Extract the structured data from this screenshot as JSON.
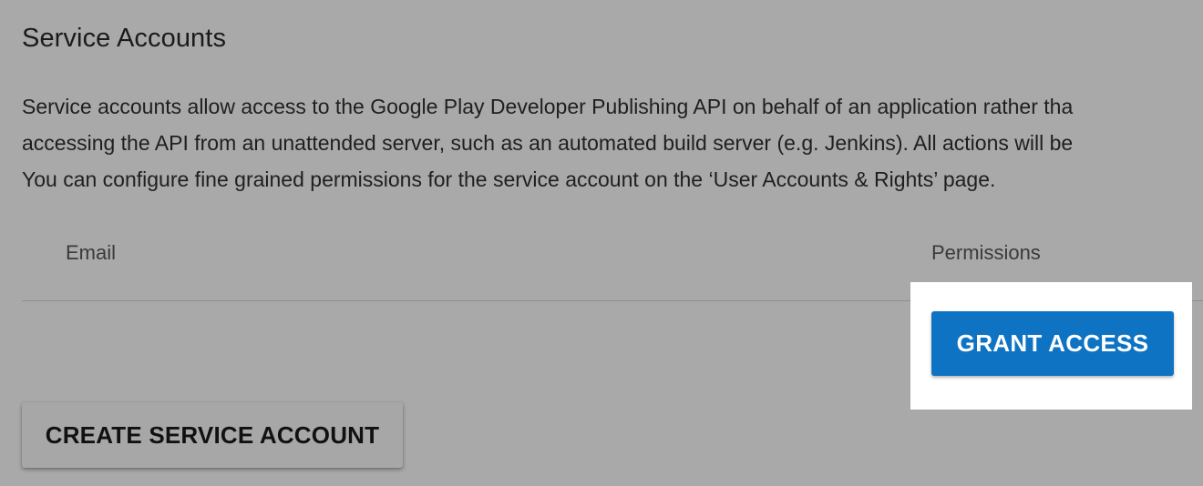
{
  "section": {
    "title": "Service Accounts",
    "description_lines": [
      "Service accounts allow access to the Google Play Developer Publishing API on behalf of an application rather tha",
      "accessing the API from an unattended server, such as an automated build server (e.g. Jenkins). All actions will be",
      "You can configure fine grained permissions for the service account on the ‘User Accounts & Rights’ page."
    ]
  },
  "table": {
    "columns": {
      "email": "Email",
      "permissions": "Permissions"
    }
  },
  "buttons": {
    "grant_access": "GRANT ACCESS",
    "create_service_account": "CREATE SERVICE ACCOUNT"
  },
  "colors": {
    "overlay_background": "#a9a9a9",
    "highlight": "#ffffff",
    "primary_button": "#0f73c3"
  }
}
